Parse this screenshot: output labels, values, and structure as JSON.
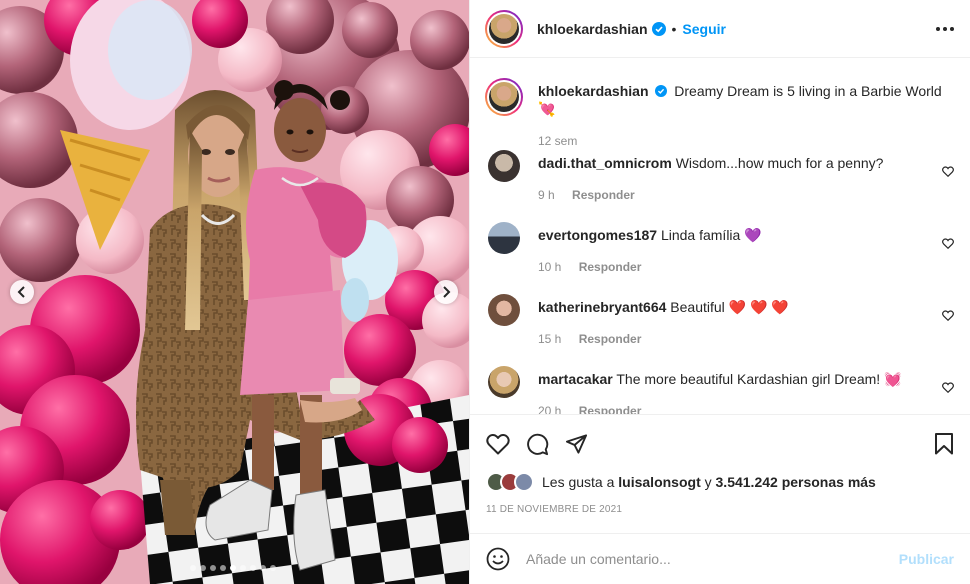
{
  "post": {
    "username": "khloekardashian",
    "follow_label": "Seguir",
    "separator": "•",
    "caption": "Dreamy Dream is 5 living in a Barbie World",
    "caption_emoji": "💘",
    "caption_time": "12 sem",
    "likes_prefix": "Les gusta a",
    "likes_user": "luisalonsogt",
    "likes_mid": "y",
    "likes_count": "3.541.242 personas más",
    "date": "11 DE NOVIEMBRE DE 2021",
    "comment_placeholder": "Añade un comentario...",
    "post_label": "Publicar"
  },
  "comments": [
    {
      "user": "dadi.that_omnicrom",
      "text": "Wisdom...how much for a penny?",
      "time": "9 h",
      "reply": "Responder"
    },
    {
      "user": "evertongomes187",
      "text": "Linda família",
      "emoji": "💜",
      "time": "10 h",
      "reply": "Responder"
    },
    {
      "user": "katherinebryant664",
      "text": "Beautiful",
      "emoji": "❤️ ❤️ ❤️",
      "time": "15 h",
      "reply": "Responder"
    },
    {
      "user": "martacakar",
      "text": "The more beautiful Kardashian girl Dream!",
      "emoji": "💓",
      "time": "20 h",
      "reply": "Responder"
    }
  ],
  "carousel": {
    "total_dots": 9,
    "active_index": 4
  },
  "colors": {
    "accent": "#0095f6",
    "text": "#262626",
    "muted": "#8e8e8e",
    "heart": "#ed4956"
  },
  "icons": [
    "verified-icon",
    "more-icon",
    "heart-icon",
    "comment-icon",
    "share-icon",
    "bookmark-icon",
    "emoji-icon",
    "chevron-left-icon",
    "chevron-right-icon"
  ]
}
